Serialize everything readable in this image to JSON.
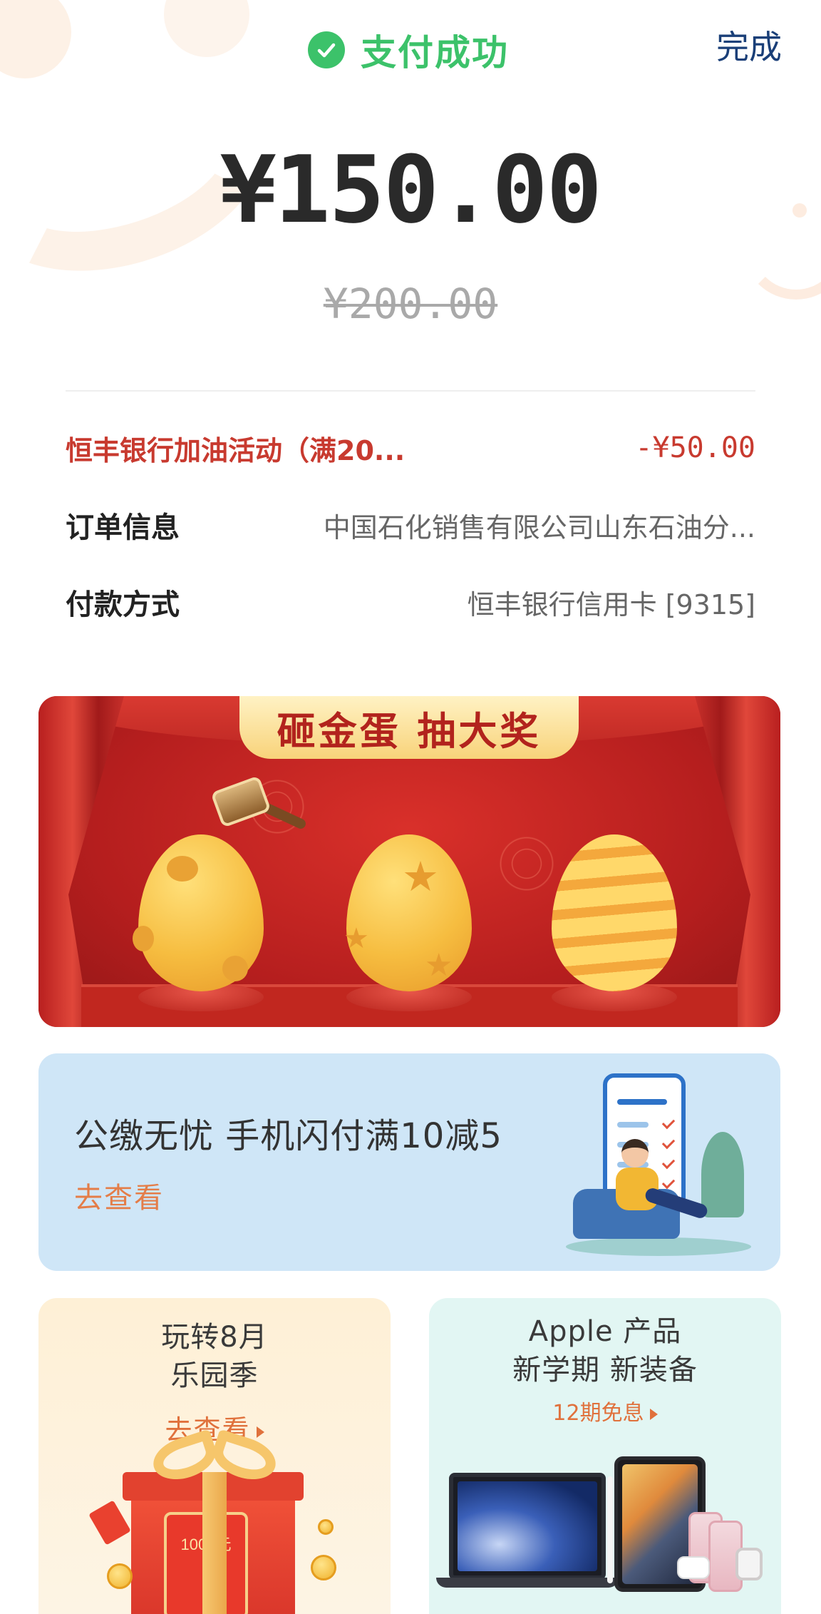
{
  "header": {
    "status_text": "支付成功",
    "done_label": "完成"
  },
  "payment": {
    "amount": "¥150.00",
    "original_amount": "¥200.00"
  },
  "details": [
    {
      "label": "恒丰银行加油活动（满20...",
      "value": "-¥50.00"
    },
    {
      "label": "订单信息",
      "value": "中国石化销售有限公司山东石油分..."
    },
    {
      "label": "付款方式",
      "value": "恒丰银行信用卡 [9315]"
    }
  ],
  "lottery_banner": {
    "title": "砸金蛋 抽大奖"
  },
  "utility_banner": {
    "title": "公缴无忧  手机闪付满10减5",
    "link": "去查看"
  },
  "cards": [
    {
      "title_line1": "玩转8月",
      "title_line2": "乐园季",
      "link": "去查看",
      "packet_text": "1000元"
    },
    {
      "title_line1": "Apple 产品",
      "title_line2": "新学期 新装备",
      "link": "12期免息"
    }
  ],
  "colors": {
    "success_green": "#3cc26a",
    "promo_red": "#c83a2f",
    "done_blue": "#1a3f78",
    "link_orange": "#e0713c"
  },
  "icons": {
    "status": "check-circle-icon"
  }
}
